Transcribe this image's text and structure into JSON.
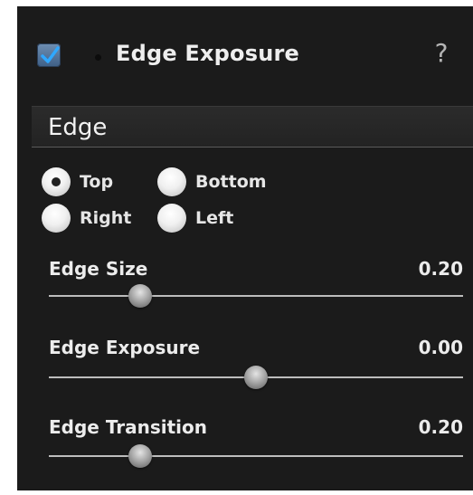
{
  "header": {
    "enabled": true,
    "title": "Edge Exposure",
    "help_label": "?"
  },
  "section": {
    "title": "Edge"
  },
  "edge_options": {
    "selected": "Top",
    "items": [
      {
        "label": "Top",
        "selected": true
      },
      {
        "label": "Bottom",
        "selected": false
      },
      {
        "label": "Right",
        "selected": false
      },
      {
        "label": "Left",
        "selected": false
      }
    ]
  },
  "sliders": [
    {
      "label": "Edge Size",
      "value": "0.20",
      "position_fraction": 0.22
    },
    {
      "label": "Edge Exposure",
      "value": "0.00",
      "position_fraction": 0.5
    },
    {
      "label": "Edge Transition",
      "value": "0.20",
      "position_fraction": 0.22
    }
  ],
  "colors": {
    "panel_background": "#1b1b1b",
    "checkbox_accent": "#4a6e96",
    "text": "#ececec"
  }
}
